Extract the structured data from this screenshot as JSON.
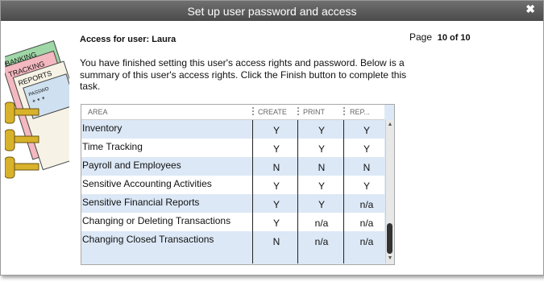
{
  "window": {
    "title": "Set up user password and access",
    "close_glyph": "✖"
  },
  "illustration": {
    "labels": [
      "BANKING",
      "TRACKING",
      "REPORTS",
      "PASSWO",
      "* * *"
    ]
  },
  "heading": "Access for user: Laura",
  "page": {
    "label": "Page",
    "value": "10 of 10"
  },
  "summary": "You have finished setting this user's access rights and password. Below is a summary of this user's access rights.  Click the Finish button to complete this task.",
  "table": {
    "columns": [
      "AREA",
      "CREATE",
      "PRINT",
      "REP..."
    ],
    "rows": [
      {
        "area": "Inventory",
        "create": "Y",
        "print": "Y",
        "rep": "Y"
      },
      {
        "area": "Time Tracking",
        "create": "Y",
        "print": "Y",
        "rep": "Y"
      },
      {
        "area": "Payroll and Employees",
        "create": "N",
        "print": "N",
        "rep": "N"
      },
      {
        "area": "Sensitive Accounting Activities",
        "create": "Y",
        "print": "Y",
        "rep": "Y"
      },
      {
        "area": "Sensitive Financial Reports",
        "create": "Y",
        "print": "Y",
        "rep": "n/a"
      },
      {
        "area": "Changing or Deleting Transactions",
        "create": "Y",
        "print": "n/a",
        "rep": "n/a"
      },
      {
        "area": "Changing Closed Transactions",
        "create": "N",
        "print": "n/a",
        "rep": "n/a"
      }
    ]
  },
  "colors": {
    "row_blue": "#dce8f6",
    "row_white": "#ffffff",
    "titlebar": "#5a5a5a"
  }
}
